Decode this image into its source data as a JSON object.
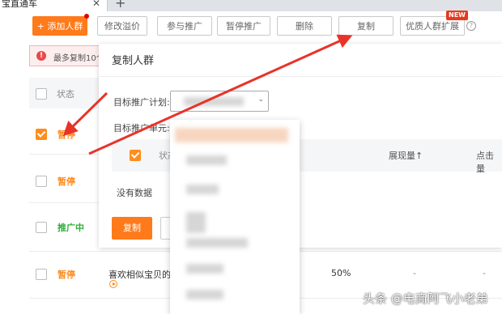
{
  "browser": {
    "tab_title": "宝直通车",
    "close_glyph": "✕",
    "new_tab_glyph": "+"
  },
  "toolbar": {
    "add_crowd": "+ 添加人群",
    "modify_premium": "修改溢价",
    "join_promo": "参与推广",
    "pause_promo": "暂停推广",
    "delete": "删除",
    "copy": "复制",
    "quality_expand": "优质人群扩展",
    "new_badge": "NEW",
    "help_glyph": "?"
  },
  "warning": {
    "icon": "!",
    "text": "最多复制10个"
  },
  "table": {
    "status_header": "状态",
    "rows": [
      {
        "status": "暂停",
        "color": "#ff8a1c"
      },
      {
        "status": "暂停",
        "color": "#ff8a1c"
      },
      {
        "status": "推广中",
        "color": "#2fae3a"
      },
      {
        "status": "暂停",
        "color": "#ff8a1c",
        "name": "喜欢相似宝贝的访客",
        "premium": "50%",
        "dash1": "-",
        "dash2": "-"
      }
    ]
  },
  "modal": {
    "title": "复制人群",
    "target_plan_label": "目标推广计划:",
    "target_unit_label": "目标推广单元:",
    "select_chevron": "⌄",
    "col_status": "状态",
    "col_impressions": "展现量↑",
    "col_clicks": "点击量",
    "no_data": "没有数据",
    "copy_button": "复制"
  },
  "watermark": "头条 @电商阿飞小老弟"
}
